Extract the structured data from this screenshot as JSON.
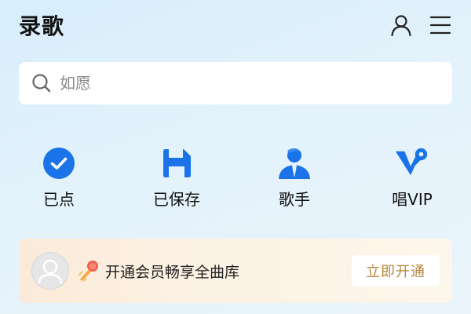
{
  "header": {
    "title": "录歌",
    "profile_icon": "user-icon",
    "menu_icon": "menu-icon"
  },
  "search": {
    "placeholder": "如愿",
    "icon": "search-icon"
  },
  "quick_actions": [
    {
      "label": "已点",
      "icon": "check-circle-icon"
    },
    {
      "label": "已保存",
      "icon": "save-icon"
    },
    {
      "label": "歌手",
      "icon": "singer-icon"
    },
    {
      "label": "唱VIP",
      "icon": "vip-icon"
    }
  ],
  "vip_banner": {
    "text": "开通会员畅享全曲库",
    "button_label": "立即开通",
    "avatar_icon": "avatar-icon",
    "mic_icon": "microphone-icon"
  },
  "colors": {
    "accent": "#1a73e8",
    "vip_gold": "#b8873c",
    "background": "#dcf0fb"
  }
}
